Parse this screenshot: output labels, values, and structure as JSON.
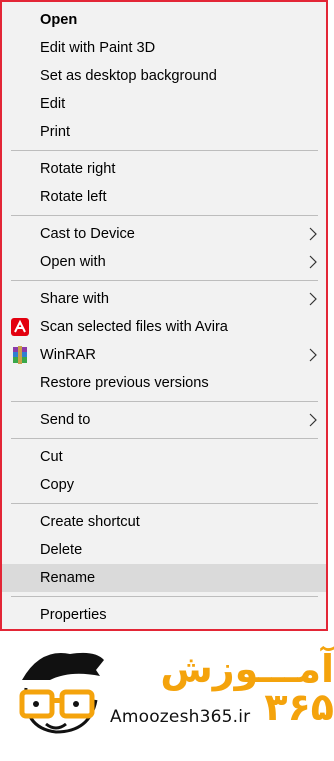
{
  "menu": {
    "groups": [
      [
        {
          "label": "Open",
          "bold": true
        },
        {
          "label": "Edit with Paint 3D"
        },
        {
          "label": "Set as desktop background"
        },
        {
          "label": "Edit"
        },
        {
          "label": "Print"
        }
      ],
      [
        {
          "label": "Rotate right"
        },
        {
          "label": "Rotate left"
        }
      ],
      [
        {
          "label": "Cast to Device",
          "submenu": true
        },
        {
          "label": "Open with",
          "submenu": true
        }
      ],
      [
        {
          "label": "Share with",
          "submenu": true
        },
        {
          "label": "Scan selected files with Avira",
          "icon": "avira-icon"
        },
        {
          "label": "WinRAR",
          "icon": "winrar-icon",
          "submenu": true
        },
        {
          "label": "Restore previous versions"
        }
      ],
      [
        {
          "label": "Send to",
          "submenu": true
        }
      ],
      [
        {
          "label": "Cut"
        },
        {
          "label": "Copy"
        }
      ],
      [
        {
          "label": "Create shortcut"
        },
        {
          "label": "Delete"
        },
        {
          "label": "Rename",
          "highlighted": true
        }
      ],
      [
        {
          "label": "Properties"
        }
      ]
    ],
    "highlight_color": "#dadada",
    "border_color": "#e32636"
  },
  "logo": {
    "site": "Amoozesh365.ir",
    "persian_text": "آمـــوزش ۳۶۵",
    "accent_color": "#f4a30c"
  }
}
